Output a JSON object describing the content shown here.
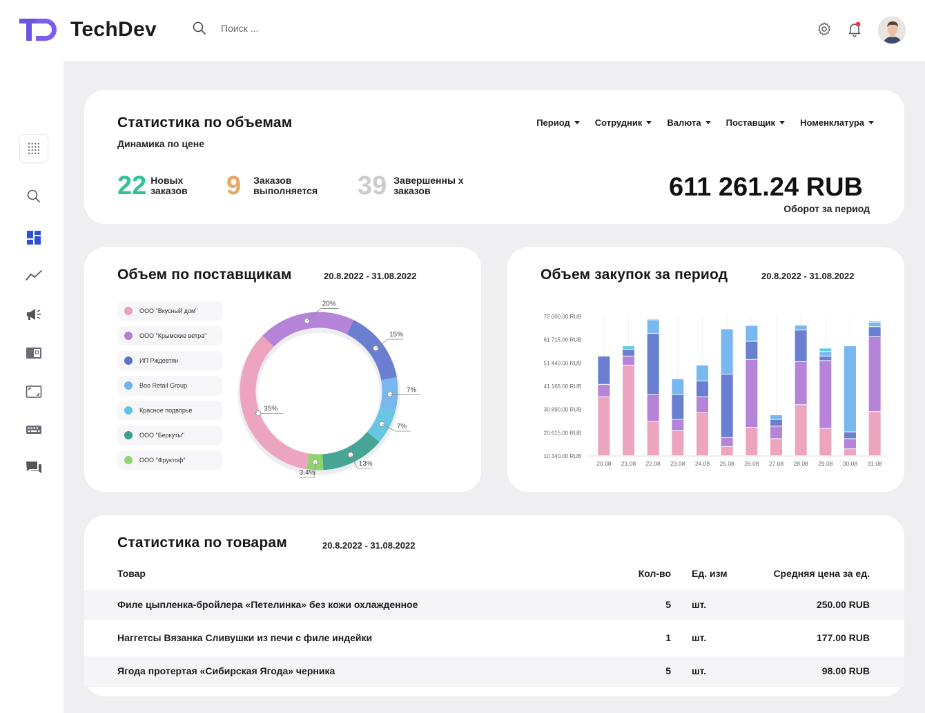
{
  "app": {
    "name": "TechDev"
  },
  "search": {
    "placeholder": "Поиск ..."
  },
  "header": {
    "icons": [
      "gear-icon",
      "bell-icon",
      "avatar"
    ]
  },
  "sidebar": {
    "items": [
      "grid-icon",
      "search-icon",
      "dashboard-icon",
      "trend-icon",
      "megaphone-icon",
      "document-icon",
      "frame-icon",
      "keyboard-icon",
      "chat-icon"
    ],
    "active": "dashboard-icon"
  },
  "stats": {
    "title": "Статистика по объемам",
    "subtitle": "Динамика по цене",
    "filters": [
      "Период",
      "Сотрудник",
      "Валюта",
      "Поставщик",
      "Номенклатура"
    ],
    "kpis": [
      {
        "value": "22",
        "label": "Новых\nзаказов",
        "color": "#2ec590"
      },
      {
        "value": "9",
        "label": "Заказов\nвыполняется",
        "color": "#e6a966"
      },
      {
        "value": "39",
        "label": "Завершенны х\nзаказов",
        "color": "#cccccc"
      }
    ],
    "turnover": "611 261.24 RUB",
    "turnover_label": "Оборот за период"
  },
  "suppliers": {
    "title": "Объем по поставщикам",
    "date_range": "20.8.2022 - 31.08.2022",
    "legend": [
      {
        "name": "ООО \"Вкусный дом\"",
        "color": "#ec9fbb"
      },
      {
        "name": "ООО \"Крымские ветра\"",
        "color": "#b47fd6"
      },
      {
        "name": "ИП Рждевтян",
        "color": "#5b72c8"
      },
      {
        "name": "Boo Retail Group",
        "color": "#6fb2ee"
      },
      {
        "name": "Красное подворье",
        "color": "#5ec3e0"
      },
      {
        "name": "ООО \"Беркуты\"",
        "color": "#3d9e8f"
      },
      {
        "name": "ООО \"Фруктоф\"",
        "color": "#8fd46e"
      }
    ]
  },
  "purchases": {
    "title": "Объем закупок за период",
    "date_range": "20.8.2022 - 31.08.2022"
  },
  "chart_data": [
    {
      "type": "pie",
      "labels": [
        "35%",
        "20%",
        "15%",
        "7%",
        "7%",
        "13%",
        "3.4%"
      ],
      "values": [
        35,
        20,
        15,
        7,
        7,
        13,
        3.4
      ],
      "colors": [
        "#eca4bf",
        "#b583d8",
        "#6a7fcf",
        "#78b8ef",
        "#67c6e2",
        "#46a595",
        "#90d46f"
      ]
    },
    {
      "type": "bar",
      "stacked": true,
      "categories": [
        "20.08",
        "21.08",
        "22.08",
        "23.08",
        "24.08",
        "25.08",
        "26.08",
        "27.08",
        "28.08",
        "29.08",
        "30.08",
        "31.08"
      ],
      "yticks": [
        "72 000.00 RUB",
        "61 715.00 RUB",
        "51 440.00 RUB",
        "41 165.00 RUB",
        "30 890.00 RUB",
        "20 615.00 RUB",
        "10 340.00 RUB"
      ],
      "ylim": [
        10340,
        72000
      ],
      "colors": [
        "#eca4bf",
        "#b583d8",
        "#6a7fcf",
        "#78b8ef",
        "#67c6e2"
      ],
      "series": [
        {
          "values": [
            26000,
            40000,
            15000,
            11000,
            19000,
            4000,
            12500,
            7500,
            22500,
            12000,
            3000,
            19500
          ]
        },
        {
          "values": [
            5500,
            4000,
            12000,
            5000,
            7000,
            4000,
            30000,
            5500,
            19000,
            30000,
            4500,
            33000
          ]
        },
        {
          "values": [
            12500,
            3000,
            27000,
            11000,
            7000,
            28000,
            8000,
            3000,
            14000,
            2000,
            3000,
            4500
          ]
        },
        {
          "values": [
            0,
            0,
            6000,
            7000,
            7000,
            20000,
            7000,
            2000,
            2000,
            2000,
            38000,
            2000
          ]
        },
        {
          "values": [
            0,
            1500,
            500,
            0,
            0,
            0,
            0,
            0,
            500,
            1500,
            0,
            500
          ]
        }
      ]
    }
  ],
  "products": {
    "title": "Статистика по товарам",
    "date_range": "20.8.2022 - 31.08.2022",
    "columns": [
      "Товар",
      "Кол-во",
      "Ед. изм",
      "Средняя цена за ед."
    ],
    "rows": [
      [
        "Филе цыпленка-бройлера «Петелинка» без кожи охлажденное",
        "5",
        "шт.",
        "250.00 RUB"
      ],
      [
        "Наггетсы Вязанка Сливушки из печи с филе индейки",
        "1",
        "шт.",
        "177.00 RUB"
      ],
      [
        "Ягода протертая «Сибирская Ягода» черника",
        "5",
        "шт.",
        "98.00 RUB"
      ]
    ]
  }
}
